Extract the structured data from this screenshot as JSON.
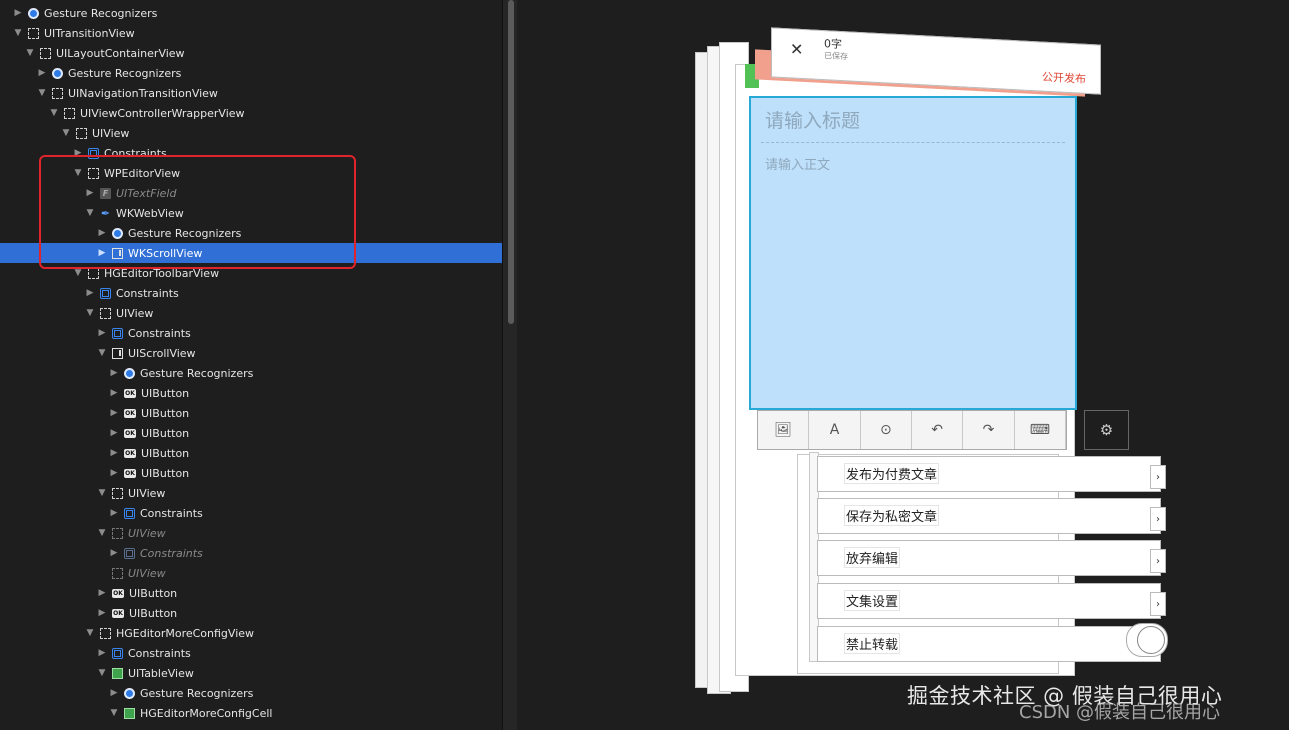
{
  "outline": [
    {
      "label": "Gesture Recognizers",
      "indent": 0,
      "icon": "gesture",
      "disclosure": "collapsed"
    },
    {
      "label": "UITransitionView",
      "indent": 0,
      "icon": "view",
      "disclosure": "expanded"
    },
    {
      "label": "UILayoutContainerView",
      "indent": 1,
      "icon": "view",
      "disclosure": "expanded"
    },
    {
      "label": "Gesture Recognizers",
      "indent": 2,
      "icon": "gesture",
      "disclosure": "collapsed"
    },
    {
      "label": "UINavigationTransitionView",
      "indent": 2,
      "icon": "view",
      "disclosure": "expanded"
    },
    {
      "label": "UIViewControllerWrapperView",
      "indent": 3,
      "icon": "view",
      "disclosure": "expanded"
    },
    {
      "label": "UIView",
      "indent": 4,
      "icon": "view",
      "disclosure": "expanded"
    },
    {
      "label": "Constraints",
      "indent": 5,
      "icon": "constraints",
      "disclosure": "collapsed"
    },
    {
      "label": "WPEditorView",
      "indent": 5,
      "icon": "view",
      "disclosure": "expanded"
    },
    {
      "label": "UITextField",
      "indent": 6,
      "icon": "textfield",
      "disclosure": "collapsed",
      "dim": true
    },
    {
      "label": "WKWebView",
      "indent": 6,
      "icon": "web",
      "disclosure": "expanded"
    },
    {
      "label": "Gesture Recognizers",
      "indent": 7,
      "icon": "gesture",
      "disclosure": "collapsed"
    },
    {
      "label": "WKScrollView",
      "indent": 7,
      "icon": "scroll",
      "disclosure": "collapsed",
      "selected": true
    },
    {
      "label": "HGEditorToolbarView",
      "indent": 5,
      "icon": "view",
      "disclosure": "expanded"
    },
    {
      "label": "Constraints",
      "indent": 6,
      "icon": "constraints",
      "disclosure": "collapsed"
    },
    {
      "label": "UIView",
      "indent": 6,
      "icon": "view",
      "disclosure": "expanded"
    },
    {
      "label": "Constraints",
      "indent": 7,
      "icon": "constraints",
      "disclosure": "collapsed"
    },
    {
      "label": "UIScrollView",
      "indent": 7,
      "icon": "scroll",
      "disclosure": "expanded"
    },
    {
      "label": "Gesture Recognizers",
      "indent": 8,
      "icon": "gesture",
      "disclosure": "collapsed"
    },
    {
      "label": "UIButton",
      "indent": 8,
      "icon": "button",
      "disclosure": "collapsed"
    },
    {
      "label": "UIButton",
      "indent": 8,
      "icon": "button",
      "disclosure": "collapsed"
    },
    {
      "label": "UIButton",
      "indent": 8,
      "icon": "button",
      "disclosure": "collapsed"
    },
    {
      "label": "UIButton",
      "indent": 8,
      "icon": "button",
      "disclosure": "collapsed"
    },
    {
      "label": "UIButton",
      "indent": 8,
      "icon": "button",
      "disclosure": "collapsed"
    },
    {
      "label": "UIView",
      "indent": 7,
      "icon": "view",
      "disclosure": "expanded"
    },
    {
      "label": "Constraints",
      "indent": 8,
      "icon": "constraints",
      "disclosure": "collapsed"
    },
    {
      "label": "UIView",
      "indent": 7,
      "icon": "view",
      "disclosure": "expanded",
      "dim": true
    },
    {
      "label": "Constraints",
      "indent": 8,
      "icon": "constraints",
      "disclosure": "collapsed",
      "dim": true
    },
    {
      "label": "UIView",
      "indent": 7,
      "icon": "view",
      "disclosure": "none",
      "dim": true
    },
    {
      "label": "UIButton",
      "indent": 7,
      "icon": "button",
      "disclosure": "collapsed"
    },
    {
      "label": "UIButton",
      "indent": 7,
      "icon": "button",
      "disclosure": "collapsed"
    },
    {
      "label": "HGEditorMoreConfigView",
      "indent": 6,
      "icon": "view",
      "disclosure": "expanded"
    },
    {
      "label": "Constraints",
      "indent": 7,
      "icon": "constraints",
      "disclosure": "collapsed"
    },
    {
      "label": "UITableView",
      "indent": 7,
      "icon": "table",
      "disclosure": "expanded"
    },
    {
      "label": "Gesture Recognizers",
      "indent": 8,
      "icon": "gesture",
      "disclosure": "collapsed"
    },
    {
      "label": "HGEditorMoreConfigCell",
      "indent": 8,
      "icon": "table",
      "disclosure": "expanded"
    }
  ],
  "button_glyph": "OK",
  "textfield_glyph": "F",
  "editor": {
    "close_symbol": "✕",
    "word_count": "0字",
    "saved_status": "已保存",
    "publish_label": "公开发布",
    "title_placeholder": "请输入标题",
    "body_placeholder": "请输入正文"
  },
  "toolbar_icons": [
    "image-icon",
    "font-icon",
    "more-icon",
    "undo-icon",
    "redo-icon",
    "keyboard-icon"
  ],
  "menu": [
    {
      "label": "发布为付费文章",
      "accessory": "chevron"
    },
    {
      "label": "保存为私密文章",
      "accessory": "chevron"
    },
    {
      "label": "放弃编辑",
      "accessory": "chevron"
    },
    {
      "label": "文集设置",
      "accessory": "chevron"
    },
    {
      "label": "禁止转载",
      "accessory": "toggle"
    }
  ],
  "watermark": {
    "primary": "掘金技术社区 @ 假装自己很用心",
    "secondary": "CSDN @假装自己很用心"
  },
  "colors": {
    "selection": "#2f6fd6",
    "highlight_box": "#e0242c",
    "editor_fill": "#bfe0fb",
    "publish": "#e04a3a"
  }
}
